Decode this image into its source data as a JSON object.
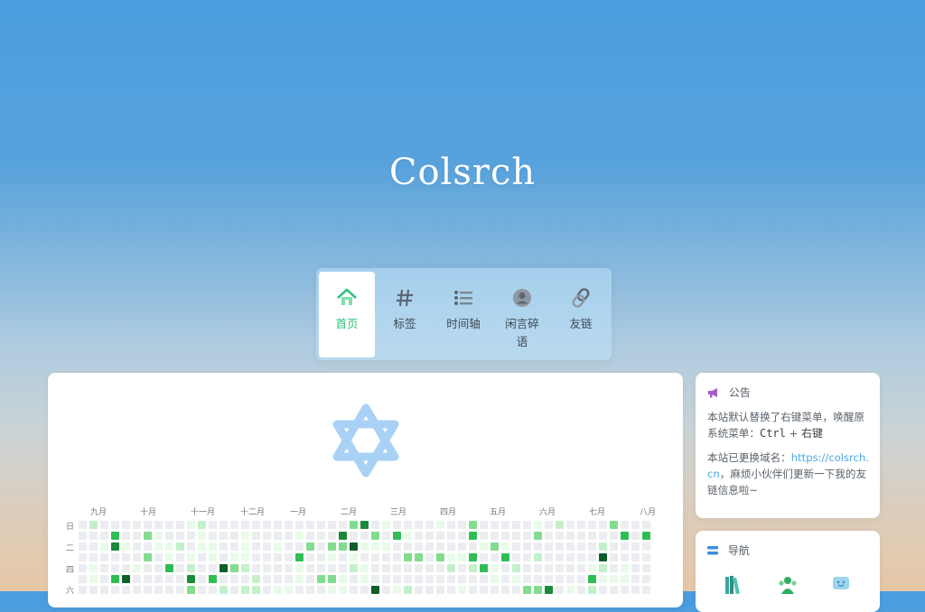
{
  "site": {
    "title": "Colsrch"
  },
  "nav": {
    "items": [
      {
        "label": "首页",
        "icon": "home-icon",
        "active": true
      },
      {
        "label": "标签",
        "icon": "hash-icon",
        "active": false
      },
      {
        "label": "时间轴",
        "icon": "list-icon",
        "active": false
      },
      {
        "label": "闲言碎语",
        "icon": "user-circle-icon",
        "active": false
      },
      {
        "label": "友链",
        "icon": "link-icon",
        "active": false
      }
    ]
  },
  "heatmap": {
    "months": [
      "九月",
      "十月",
      "十一月",
      "十二月",
      "一月",
      "二月",
      "三月",
      "四月",
      "五月",
      "六月",
      "七月",
      "八月"
    ],
    "weekdays": [
      "日",
      "二",
      "四",
      "六"
    ],
    "colors": [
      "#ebedf0",
      "#e8fbe8",
      "#c4f0c9",
      "#82dc8e",
      "#2fbe54",
      "#1a8a3a",
      "#0d5f28"
    ],
    "weeks": 53
  },
  "notice": {
    "title": "公告",
    "para1_text": "本站默认替换了右键菜单，唤醒原系统菜单：",
    "para1_kbd": "Ctrl",
    "para1_plus": " + ",
    "para1_key2": "右键",
    "para2_text": "本站已更换域名：",
    "para2_link": "https://colsrch.cn",
    "para2_after": "，麻烦小伙伴们更新一下我的友链信息啦~"
  },
  "nav_card": {
    "title": "导航"
  },
  "colors": {
    "accent": "#31c27c",
    "link": "#49a9e6",
    "star": "#a9d1f5"
  }
}
